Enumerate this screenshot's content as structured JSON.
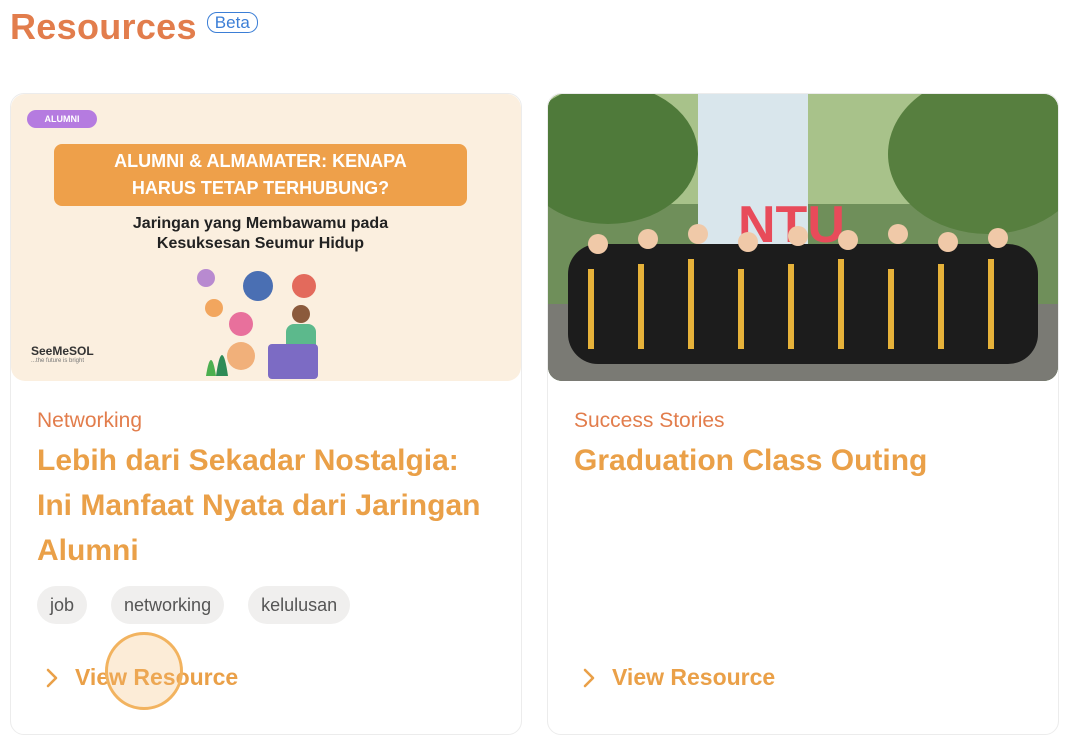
{
  "header": {
    "title": "Resources",
    "badge": "Beta"
  },
  "cards": [
    {
      "thumbnail": {
        "pill": "ALUMNI",
        "banner_line1": "ALUMNI & ALMAMATER: KENAPA",
        "banner_line2": "HARUS TETAP TERHUBUNG?",
        "subtitle_line1": "Jaringan yang Membawamu pada",
        "subtitle_line2": "Kesuksesan Seumur Hidup",
        "brand": "SeeMeSOL",
        "brand_tagline": "...the future is bright"
      },
      "category": "Networking",
      "title": "Lebih dari Sekadar Nostalgia: Ini Manfaat Nyata dari Jaringan Alumni",
      "tags": [
        "job",
        "networking",
        "kelulusan"
      ],
      "link_label": "View Resource"
    },
    {
      "thumbnail": {
        "sign": "NTU"
      },
      "category": "Success Stories",
      "title": "Graduation Class Outing",
      "tags": [],
      "link_label": "View Resource"
    }
  ],
  "colors": {
    "accent": "#e27d4c",
    "title": "#eaa048",
    "badge": "#3b7ed6"
  }
}
